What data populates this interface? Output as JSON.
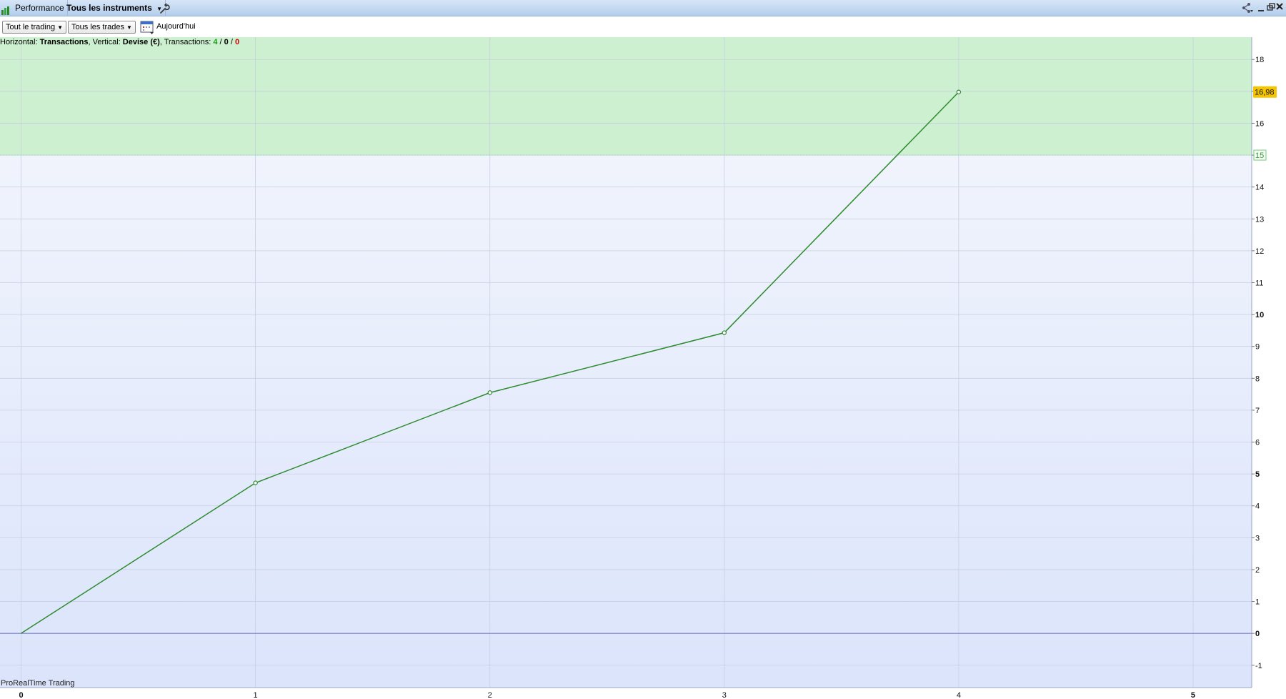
{
  "titlebar": {
    "tab_performance": "Performance",
    "tab_instruments": "Tous les instruments",
    "wrench_icon": "wrench-icon",
    "share_icon": "share-icon",
    "minimize_icon": "minimize-icon",
    "restore_icon": "restore-icon",
    "close_icon": "close-icon"
  },
  "toolbar": {
    "trading_select": "Tout le trading",
    "trades_select": "Tous les trades",
    "calendar_icon": "calendar-icon",
    "today_label": "Aujourd'hui"
  },
  "info": {
    "h_label": "Horizontal: ",
    "h_value": "Transactions",
    "v_label": ", Vertical: ",
    "v_value": "Devise (€)",
    "t_label": ", Transactions: ",
    "t_won": "4",
    "sep1": " / ",
    "t_neutral": "0",
    "sep2": " / ",
    "t_lost": "0"
  },
  "watermark": "ProRealTime Trading",
  "colors": {
    "line": "#2e8b2e",
    "profit_zone": "#ccf0d0",
    "background_top": "#f5f7fd",
    "background_bottom": "#dbe4fb",
    "zero_line": "#7b7fd4",
    "last_value_badge": "#f4c500"
  },
  "chart_data": {
    "type": "line",
    "x": [
      0,
      1,
      2,
      3,
      4
    ],
    "values": [
      0,
      4.72,
      7.55,
      9.43,
      16.98
    ],
    "xlim": [
      -0.09,
      5.25
    ],
    "ylim": [
      -1.7,
      18.7
    ],
    "x_ticks": [
      "0",
      "1",
      "2",
      "3",
      "4",
      "5"
    ],
    "x_ticks_bold": [
      "0",
      "5"
    ],
    "y_ticks": [
      "-1",
      "0",
      "1",
      "2",
      "3",
      "4",
      "5",
      "6",
      "7",
      "8",
      "9",
      "10",
      "11",
      "12",
      "13",
      "14",
      "15",
      "16",
      "17",
      "18"
    ],
    "y_tick_labels": [
      "-1",
      "0",
      "1",
      "2",
      "3",
      "4",
      "5",
      "6",
      "7",
      "8",
      "9",
      "10",
      "11",
      "12",
      "13",
      "14",
      "",
      "16",
      "",
      "18"
    ],
    "y_ticks_bold": [
      "0",
      "5",
      "10"
    ],
    "profit_zone_from": 15,
    "profit_zone_label": "15",
    "last_value_label": "16,98",
    "grid": true
  }
}
